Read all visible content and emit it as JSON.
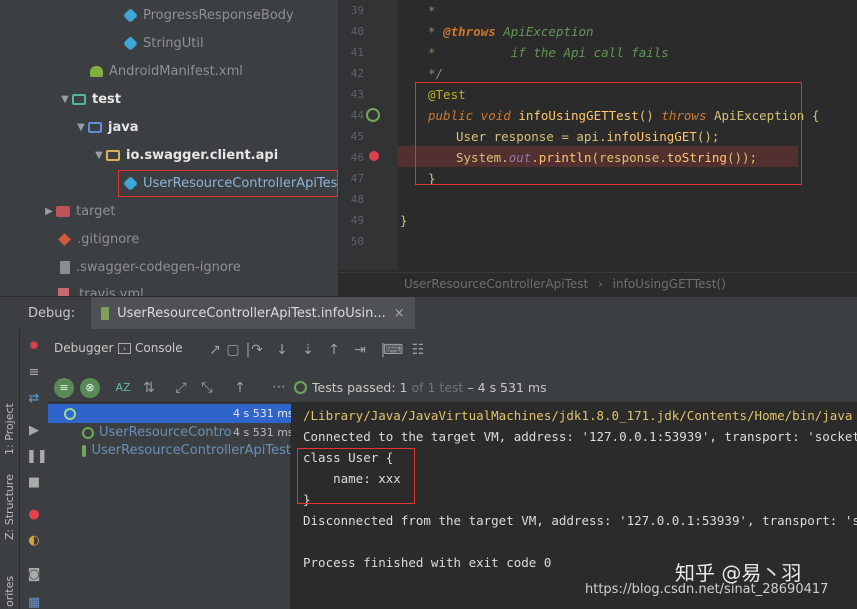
{
  "project_tree": {
    "items": [
      {
        "label": "ProgressResponseBody"
      },
      {
        "label": "StringUtil"
      },
      {
        "label": "AndroidManifest.xml"
      },
      {
        "label": "test"
      },
      {
        "label": "java"
      },
      {
        "label": "io.swagger.client.api"
      },
      {
        "label": "UserResourceControllerApiTest"
      },
      {
        "label": "target"
      },
      {
        "label": ".gitignore"
      },
      {
        "label": ".swagger-codegen-ignore"
      },
      {
        "label": ".travis.yml"
      }
    ]
  },
  "editor": {
    "line_numbers": [
      "39",
      "40",
      "41",
      "42",
      "43",
      "44",
      "45",
      "46",
      "47",
      "48",
      "49",
      "50"
    ],
    "code": {
      "l39": "*",
      "l40_star": "* ",
      "l40_tag": "@throws",
      "l40_rest": " ApiException",
      "l41": "*          if the Api call fails",
      "l42": "*/",
      "l43": "@Test",
      "l44_kw": "public void ",
      "l44_fn": "infoUsingGETTest",
      "l44_mid": "() ",
      "l44_kw2": "throws",
      "l44_end": " ApiException {",
      "l45_a": "User response = api.",
      "l45_fn": "infoUsingGET",
      "l45_b": "();",
      "l46_a": "System.",
      "l46_field": "out",
      "l46_b": ".",
      "l46_fn": "println",
      "l46_c": "(response.",
      "l46_fn2": "toString",
      "l46_d": "());",
      "l47": "}",
      "l49": "}"
    },
    "breadcrumb": {
      "file": "UserResourceControllerApiTest",
      "sep": "›",
      "method": "infoUsingGETTest()"
    }
  },
  "debug": {
    "label": "Debug:",
    "tab_label": "UserResourceControllerApiTest.infoUsin...",
    "tab_close": "×",
    "toolbar": {
      "debugger_label": "Debugger",
      "console_label": "Console"
    },
    "tests_passed": {
      "label": "Tests passed:",
      "count": "1",
      "of": "of 1 test",
      "duration": "– 4 s 531 ms"
    },
    "test_tree": [
      {
        "label": "",
        "time": "4 s 531 ms"
      },
      {
        "label": "UserResourceContro",
        "time": "4 s 531 ms"
      },
      {
        "label": "UserResourceControllerApiTest",
        "time": ""
      }
    ],
    "console_lines": [
      "/Library/Java/JavaVirtualMachines/jdk1.8.0_171.jdk/Contents/Home/bin/java ...",
      "Connected to the target VM, address: '127.0.0.1:53939', transport: 'socket'",
      "class User {",
      "    name: xxx",
      "}",
      "Disconnected from the target VM, address: '127.0.0.1:53939', transport: 'socket'",
      "",
      "Process finished with exit code 0"
    ],
    "side_tabs": {
      "project": "1: Project",
      "structure": "Z: Structure",
      "favorites": "orites"
    }
  },
  "watermark": {
    "zhihu": "知乎 @易丶羽",
    "url": "https://blog.csdn.net/sinat_28690417"
  },
  "colors": {
    "highlight_box": "#e0342c",
    "breakpoint": "#e0414a",
    "passed_green": "#6fa85a",
    "selection_blue": "#2f65ca"
  }
}
